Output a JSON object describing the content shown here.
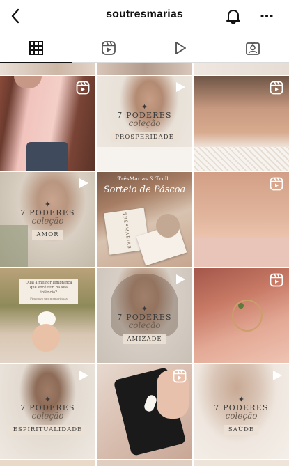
{
  "header": {
    "username": "soutresmarias",
    "back_icon": "chevron-left-icon",
    "bell_icon": "bell-icon",
    "more_icon": "more-horizontal-icon"
  },
  "tabs": [
    {
      "name": "grid",
      "icon": "grid-icon",
      "active": true
    },
    {
      "name": "reels",
      "icon": "reels-icon",
      "active": false
    },
    {
      "name": "videos",
      "icon": "play-icon",
      "active": false
    },
    {
      "name": "tagged",
      "icon": "tagged-icon",
      "active": false
    }
  ],
  "posts": {
    "r1c2": {
      "title": "7 PODERES",
      "script": "coleção",
      "label": "PROSPERIDADE"
    },
    "r2c1": {
      "title": "7 PODERES",
      "script": "coleção",
      "label": "AMOR"
    },
    "r2c2": {
      "top": "TrêsMarias & Trullo",
      "script": "Sorteio de Páscoa",
      "box": "TRÊSMARIAS"
    },
    "r3c1": {
      "question": "Qual a melhor lembrança que você tem da sua infância?",
      "footer": "Fim novo uns memorinhas"
    },
    "r3c2": {
      "title": "7 PODERES",
      "script": "coleção",
      "label": "AMIZADE"
    },
    "r4c1": {
      "title": "7 PODERES",
      "script": "coleção",
      "label": "ESPIRITUALIDADE"
    },
    "r4c3": {
      "title": "7 PODERES",
      "script": "coleção",
      "label": "SAÚDE"
    }
  },
  "colors": {
    "accent_text": "#111111",
    "divider": "#dbdbdb"
  }
}
